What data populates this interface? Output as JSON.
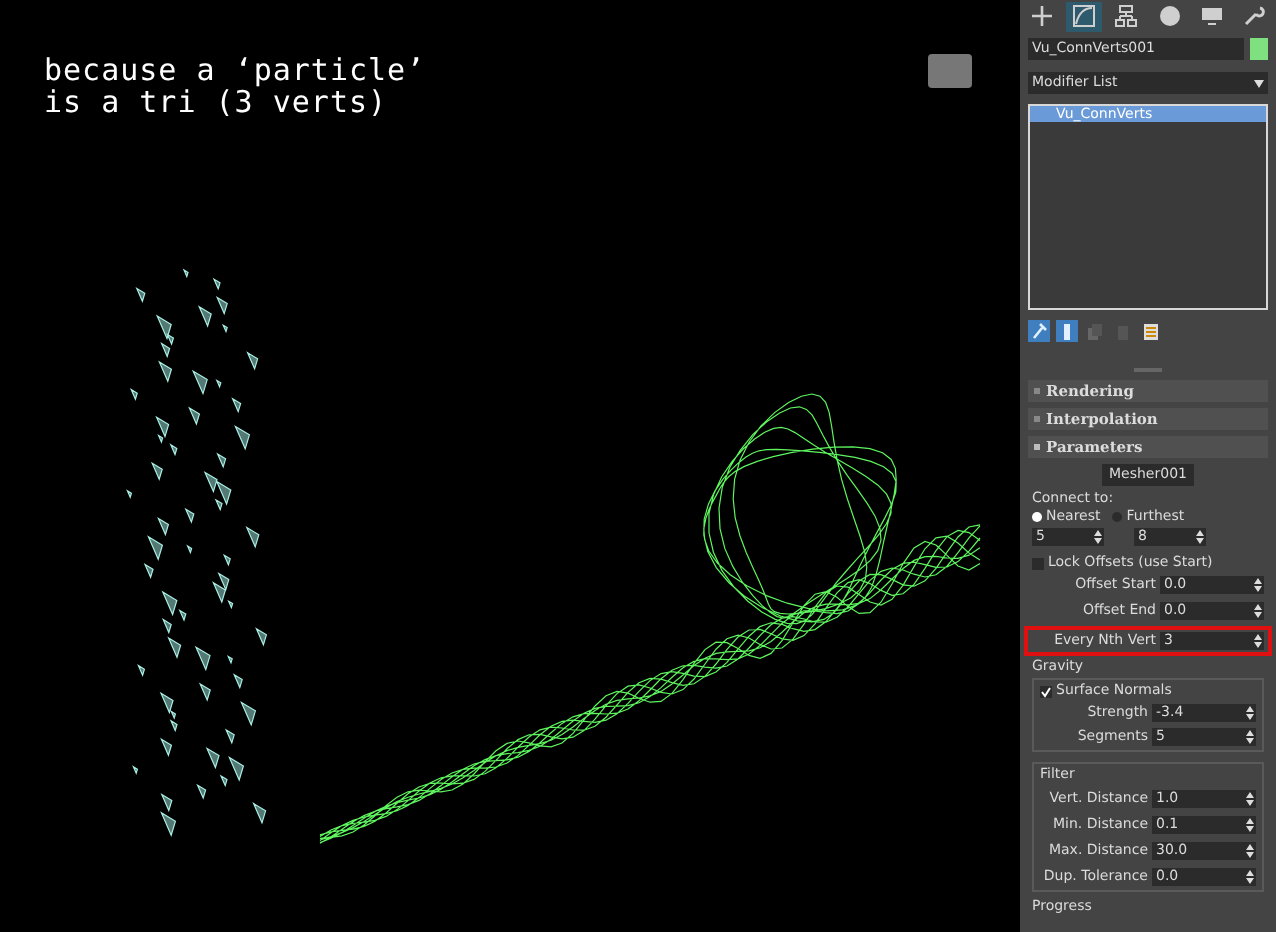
{
  "viewport": {
    "caption_lines": [
      "because a ‘particle’",
      "is a tri (3 verts)"
    ]
  },
  "command_tabs": [
    {
      "kind": "create",
      "selected": false
    },
    {
      "kind": "modify",
      "selected": true
    },
    {
      "kind": "hierarchy",
      "selected": false
    },
    {
      "kind": "motion",
      "selected": false
    },
    {
      "kind": "display",
      "selected": false
    },
    {
      "kind": "utilities",
      "selected": false
    }
  ],
  "object_name": {
    "value": "Vu_ConnVerts001",
    "color": "#7ee07e"
  },
  "modifier_list": {
    "label": "Modifier List"
  },
  "stack": [
    {
      "label": "Vu_ConnVerts",
      "selected": true
    }
  ],
  "stack_tools": [
    {
      "kind": "pin",
      "selected": true
    },
    {
      "kind": "show-end",
      "selected": true
    },
    {
      "kind": "unique",
      "selected": false
    },
    {
      "kind": "remove",
      "selected": false
    },
    {
      "kind": "configure",
      "selected": false
    }
  ],
  "rollouts": [
    {
      "title": "Rendering",
      "expanded": false
    },
    {
      "title": "Interpolation",
      "expanded": false
    },
    {
      "title": "Parameters",
      "expanded": true
    }
  ],
  "parameters": {
    "mesher_button": "Mesher001",
    "connect_label": "Connect to:",
    "radios": [
      {
        "label": "Nearest",
        "selected": true
      },
      {
        "label": "Furthest",
        "selected": false
      }
    ],
    "counts": [
      "5",
      "8"
    ],
    "lock_offsets": {
      "label": "Lock Offsets (use Start)",
      "checked": false
    },
    "fields": [
      {
        "label": "Offset Start",
        "value": "0.0",
        "highlighted": false
      },
      {
        "label": "Offset End",
        "value": "0.0",
        "highlighted": false
      },
      {
        "label": "Every Nth Vert",
        "value": "3",
        "highlighted": true
      }
    ],
    "gravity": {
      "title": "Gravity",
      "surface_normals": {
        "label": "Surface Normals",
        "checked": true
      },
      "fields": [
        {
          "label": "Strength",
          "value": "-3.4"
        },
        {
          "label": "Segments",
          "value": "5"
        }
      ]
    },
    "filter": {
      "title": "Filter",
      "fields": [
        {
          "label": "Vert. Distance",
          "value": "1.0"
        },
        {
          "label": "Min. Distance",
          "value": "0.1"
        },
        {
          "label": "Max. Distance",
          "value": "30.0"
        },
        {
          "label": "Dup. Tolerance",
          "value": "0.0"
        }
      ]
    },
    "progress_title": "Progress"
  }
}
